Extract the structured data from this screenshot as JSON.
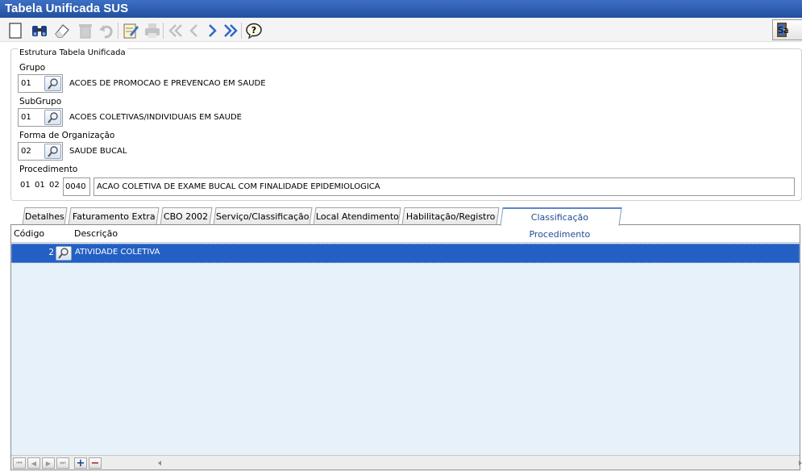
{
  "window": {
    "title": "Tabela Unificada SUS"
  },
  "toolbar": {
    "items": [
      "new-icon",
      "binoculars-icon",
      "eraser-icon",
      "trash-icon",
      "undo-icon",
      "edit-icon",
      "print-icon",
      "first-icon",
      "prev-icon",
      "next-icon",
      "last-icon",
      "help-icon"
    ],
    "exit_label": "Sa"
  },
  "structure": {
    "legend": "Estrutura Tabela Unificada",
    "grupo": {
      "label": "Grupo",
      "code": "01",
      "description": "ACOES DE PROMOCAO E PREVENCAO EM SAUDE"
    },
    "subgrupo": {
      "label": "SubGrupo",
      "code": "01",
      "description": "ACOES COLETIVAS/INDIVIDUAIS EM SAUDE"
    },
    "forma": {
      "label": "Forma de Organização",
      "code": "02",
      "description": "SAUDE BUCAL"
    },
    "procedimento": {
      "label": "Procedimento",
      "parts": [
        "01",
        "01",
        "02"
      ],
      "code": "0040",
      "description": "ACAO COLETIVA DE EXAME BUCAL COM FINALIDADE EPIDEMIOLOGICA"
    }
  },
  "tabs": [
    {
      "label": "Detalhes",
      "active": false
    },
    {
      "label": "Faturamento Extra",
      "active": false
    },
    {
      "label": "CBO 2002",
      "active": false
    },
    {
      "label": "Serviço/Classificação",
      "active": false
    },
    {
      "label": "Local Atendimento",
      "active": false
    },
    {
      "label": "Habilitação/Registro",
      "active": false
    },
    {
      "label": "Classificação Procedimento",
      "active": true
    }
  ],
  "grid": {
    "columns": [
      "Código",
      "Descrição"
    ],
    "rows": [
      {
        "code": "2",
        "description": "ATIVIDADE COLETIVA",
        "selected": true
      }
    ],
    "footer": {
      "add_label": "+",
      "remove_label": "−"
    }
  },
  "colors": {
    "title_bar": "#2a59a8",
    "selected_row": "#2460c3",
    "grid_bg": "#e6f1f9",
    "active_tab_text": "#1d4c97"
  }
}
